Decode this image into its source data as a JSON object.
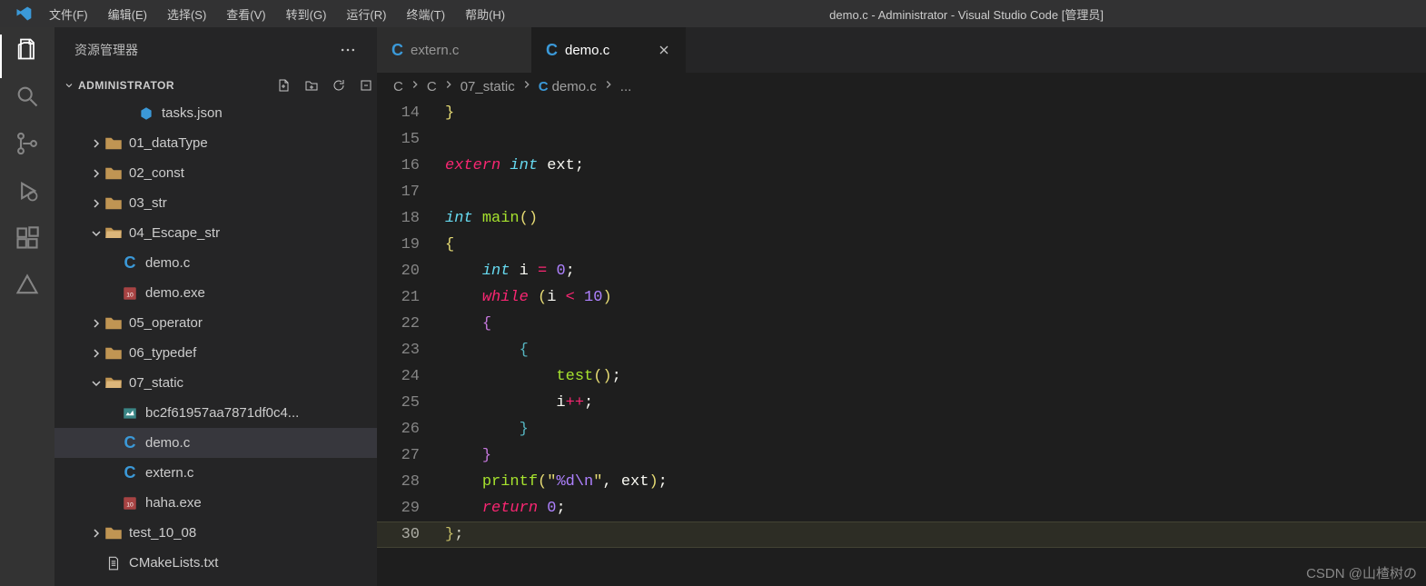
{
  "title": "demo.c - Administrator - Visual Studio Code [管理员]",
  "menus": [
    "文件(F)",
    "编辑(E)",
    "选择(S)",
    "查看(V)",
    "转到(G)",
    "运行(R)",
    "终端(T)",
    "帮助(H)"
  ],
  "sidebar": {
    "header": "资源管理器",
    "folder": "ADMINISTRATOR",
    "tree": [
      {
        "label": "tasks.json",
        "indent": 3,
        "icon": "json",
        "expanded": null
      },
      {
        "label": "01_dataType",
        "indent": 1,
        "icon": "folder",
        "expanded": false
      },
      {
        "label": "02_const",
        "indent": 1,
        "icon": "folder",
        "expanded": false
      },
      {
        "label": "03_str",
        "indent": 1,
        "icon": "folder",
        "expanded": false
      },
      {
        "label": "04_Escape_str",
        "indent": 1,
        "icon": "folder-open",
        "expanded": true
      },
      {
        "label": "demo.c",
        "indent": 2,
        "icon": "c",
        "expanded": null
      },
      {
        "label": "demo.exe",
        "indent": 2,
        "icon": "exe",
        "expanded": null
      },
      {
        "label": "05_operator",
        "indent": 1,
        "icon": "folder",
        "expanded": false
      },
      {
        "label": "06_typedef",
        "indent": 1,
        "icon": "folder",
        "expanded": false
      },
      {
        "label": "07_static",
        "indent": 1,
        "icon": "folder-open",
        "expanded": true
      },
      {
        "label": "bc2f61957aa7871df0c4...",
        "indent": 2,
        "icon": "img",
        "expanded": null
      },
      {
        "label": "demo.c",
        "indent": 2,
        "icon": "c",
        "expanded": null,
        "selected": true
      },
      {
        "label": "extern.c",
        "indent": 2,
        "icon": "c",
        "expanded": null
      },
      {
        "label": "haha.exe",
        "indent": 2,
        "icon": "exe",
        "expanded": null
      },
      {
        "label": "test_10_08",
        "indent": 1,
        "icon": "folder",
        "expanded": false
      },
      {
        "label": "CMakeLists.txt",
        "indent": 1,
        "icon": "txt",
        "expanded": null
      }
    ]
  },
  "tabs": [
    {
      "label": "extern.c",
      "icon": "c",
      "active": false
    },
    {
      "label": "demo.c",
      "icon": "c",
      "active": true
    }
  ],
  "breadcrumb": [
    "C",
    "C",
    "07_static",
    "demo.c",
    "..."
  ],
  "code": {
    "start": 14,
    "lines": [
      [
        [
          "}",
          "brace"
        ]
      ],
      [],
      [
        [
          "extern",
          "keyword"
        ],
        [
          " ",
          null
        ],
        [
          "int",
          "type"
        ],
        [
          " ",
          null
        ],
        [
          "ext",
          "var"
        ],
        [
          ";",
          "punc"
        ]
      ],
      [],
      [
        [
          "int",
          "type"
        ],
        [
          " ",
          null
        ],
        [
          "main",
          "func"
        ],
        [
          "()",
          "brace"
        ]
      ],
      [
        [
          "{",
          "brace"
        ]
      ],
      [
        [
          "    ",
          null
        ],
        [
          "int",
          "type"
        ],
        [
          " ",
          null
        ],
        [
          "i",
          "var"
        ],
        [
          " ",
          null
        ],
        [
          "=",
          "op"
        ],
        [
          " ",
          null
        ],
        [
          "0",
          "num"
        ],
        [
          ";",
          "punc"
        ]
      ],
      [
        [
          "    ",
          null
        ],
        [
          "while",
          "keyword"
        ],
        [
          " ",
          null
        ],
        [
          "(",
          "brace"
        ],
        [
          "i ",
          "var"
        ],
        [
          "<",
          "op"
        ],
        [
          " ",
          null
        ],
        [
          "10",
          "num"
        ],
        [
          ")",
          "brace"
        ]
      ],
      [
        [
          "    ",
          null
        ],
        [
          "{",
          "brace-p"
        ]
      ],
      [
        [
          "        ",
          null
        ],
        [
          "{",
          "brace-b"
        ]
      ],
      [
        [
          "            ",
          null
        ],
        [
          "test",
          "func"
        ],
        [
          "()",
          "brace"
        ],
        [
          ";",
          "punc"
        ]
      ],
      [
        [
          "            ",
          null
        ],
        [
          "i",
          "var"
        ],
        [
          "++",
          "op"
        ],
        [
          ";",
          "punc"
        ]
      ],
      [
        [
          "        ",
          null
        ],
        [
          "}",
          "brace-b"
        ]
      ],
      [
        [
          "    ",
          null
        ],
        [
          "}",
          "brace-p"
        ]
      ],
      [
        [
          "    ",
          null
        ],
        [
          "printf",
          "func"
        ],
        [
          "(",
          "brace"
        ],
        [
          "\"",
          "str"
        ],
        [
          "%d",
          "esc"
        ],
        [
          "\\n",
          "esc"
        ],
        [
          "\"",
          "str"
        ],
        [
          ", ",
          "punc"
        ],
        [
          "ext",
          "var"
        ],
        [
          ")",
          "brace"
        ],
        [
          ";",
          "punc"
        ]
      ],
      [
        [
          "    ",
          null
        ],
        [
          "return",
          "keyword"
        ],
        [
          " ",
          null
        ],
        [
          "0",
          "num"
        ],
        [
          ";",
          "punc"
        ]
      ],
      [
        [
          "}",
          "brace"
        ],
        [
          ";",
          "punc"
        ]
      ]
    ],
    "current_line": 30
  },
  "watermark": "CSDN @山楂树の"
}
